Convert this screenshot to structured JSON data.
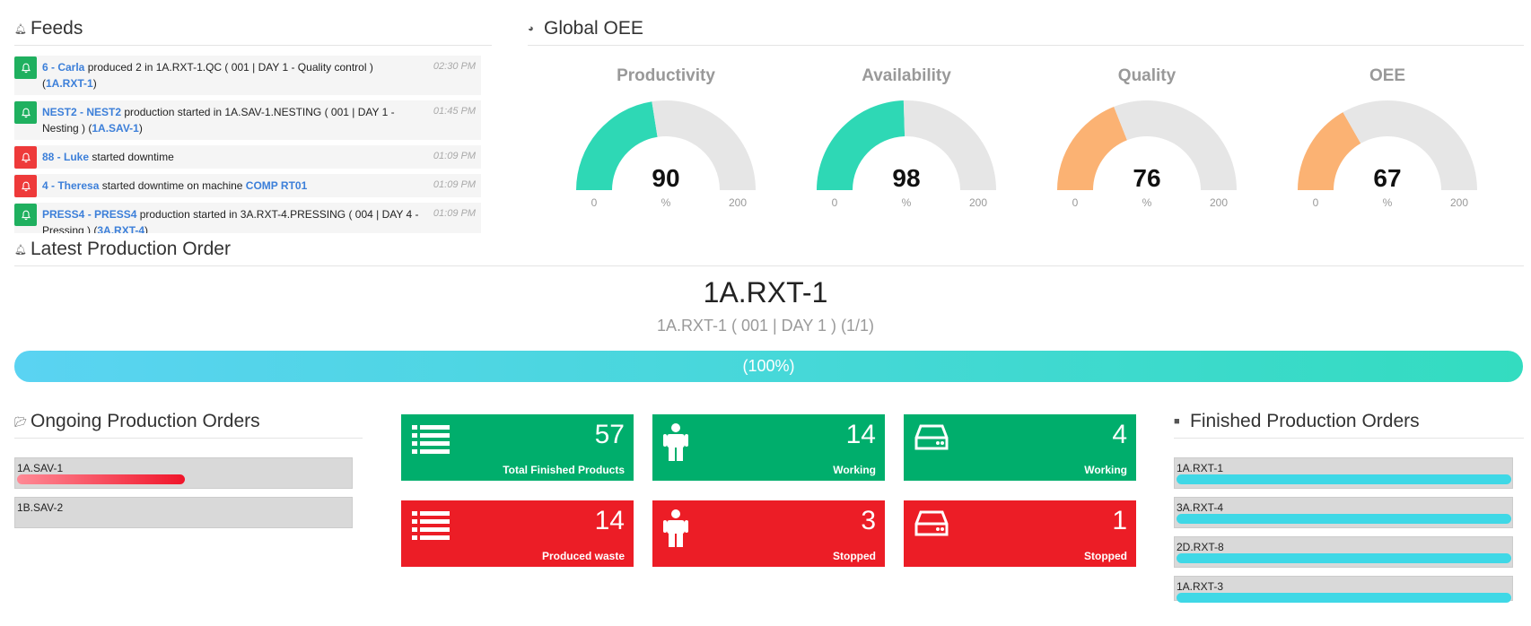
{
  "feeds": {
    "title": "Feeds",
    "items": [
      {
        "color": "green",
        "who": "6 - Carla",
        "text": " produced 2 in 1A.RXT-1.QC ( 001 | DAY 1 - Quality control ) (",
        "link": "1A.RXT-1",
        "tail": ")",
        "time": "02:30 PM"
      },
      {
        "color": "green",
        "who": "NEST2 - NEST2",
        "text": " production started in 1A.SAV-1.NESTING ( 001 | DAY 1 - Nesting ) (",
        "link": "1A.SAV-1",
        "tail": ")",
        "time": "01:45 PM"
      },
      {
        "color": "red",
        "who": "88 - Luke",
        "text": " started downtime",
        "link": "",
        "tail": "",
        "time": "01:09 PM"
      },
      {
        "color": "red",
        "who": "4 - Theresa",
        "text": " started downtime on machine ",
        "link": "COMP RT01",
        "tail": "",
        "time": "01:09 PM"
      },
      {
        "color": "green",
        "who": "PRESS4 - PRESS4",
        "text": " production started in 3A.RXT-4.PRESSING ( 004 | DAY 4 - Pressing ) (",
        "link": "3A.RXT-4",
        "tail": ")",
        "time": "01:09 PM"
      }
    ]
  },
  "oee": {
    "title": "Global OEE",
    "gauges": [
      {
        "label": "Productivity",
        "value": 90,
        "min": 0,
        "max": 200,
        "unit": "%",
        "color": "#2ed8b5"
      },
      {
        "label": "Availability",
        "value": 98,
        "min": 0,
        "max": 200,
        "unit": "%",
        "color": "#2ed8b5"
      },
      {
        "label": "Quality",
        "value": 76,
        "min": 0,
        "max": 200,
        "unit": "%",
        "color": "#fbb273"
      },
      {
        "label": "OEE",
        "value": 67,
        "min": 0,
        "max": 200,
        "unit": "%",
        "color": "#fbb273"
      }
    ]
  },
  "latest": {
    "title": "Latest Production Order",
    "code": "1A.RXT-1",
    "subtitle": "1A.RXT-1 ( 001 | DAY 1 ) (1/1)",
    "progress_label": "(100%)",
    "progress": 1.0
  },
  "ongoing": {
    "title": "Ongoing Production Orders",
    "items": [
      {
        "name": "1A.SAV-1",
        "progress": 0.5,
        "color": "#f0152a"
      },
      {
        "name": "1B.SAV-2",
        "progress": 0,
        "color": "#f0152a"
      }
    ]
  },
  "tiles": [
    {
      "value": "57",
      "label": "Total Finished Products",
      "color": "green",
      "icon": "list-icon"
    },
    {
      "value": "14",
      "label": "Working",
      "color": "green",
      "icon": "person-icon"
    },
    {
      "value": "4",
      "label": "Working",
      "color": "green",
      "icon": "machine-icon"
    },
    {
      "value": "14",
      "label": "Produced waste",
      "color": "red",
      "icon": "list-icon"
    },
    {
      "value": "3",
      "label": "Stopped",
      "color": "red",
      "icon": "person-icon"
    },
    {
      "value": "1",
      "label": "Stopped",
      "color": "red",
      "icon": "machine-icon"
    }
  ],
  "finished": {
    "title": "Finished Production Orders",
    "items": [
      {
        "name": "1A.RXT-1",
        "progress": 1.0
      },
      {
        "name": "3A.RXT-4",
        "progress": 1.0
      },
      {
        "name": "2D.RXT-8",
        "progress": 1.0
      },
      {
        "name": "1A.RXT-3",
        "progress": 1.0
      }
    ]
  }
}
